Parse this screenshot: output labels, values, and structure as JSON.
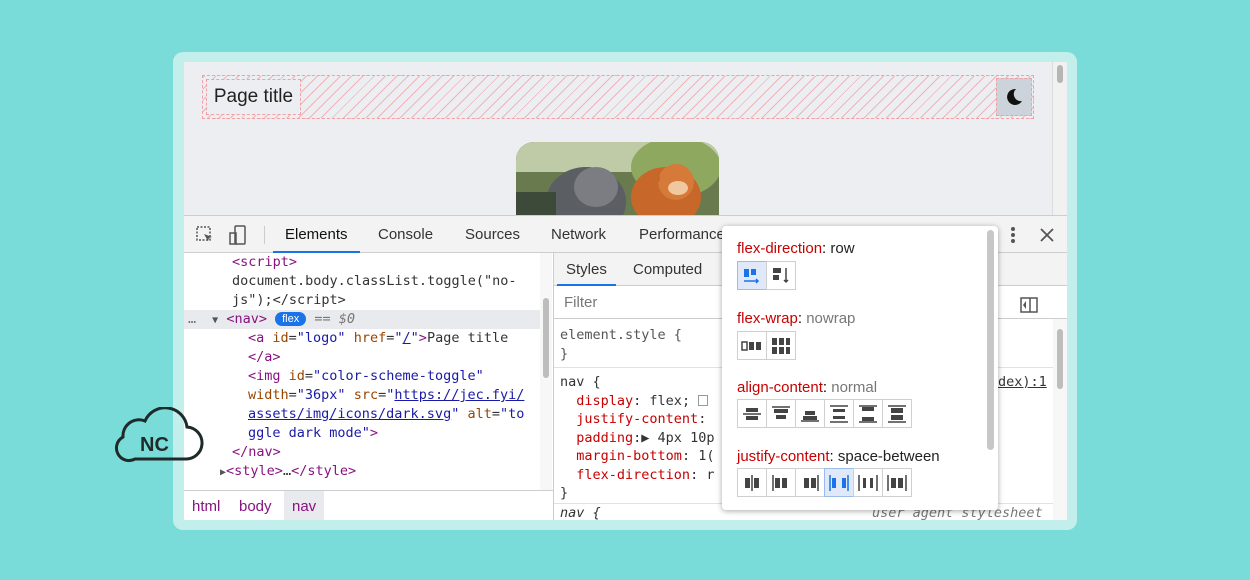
{
  "preview": {
    "page_title": "Page title"
  },
  "devtools": {
    "tabs": [
      "Elements",
      "Console",
      "Sources",
      "Network",
      "Performance"
    ],
    "elements_lines": {
      "l1": "<script>",
      "l2": "document.body.classList.toggle(\"no-",
      "l3": "js\");</script>",
      "nav_open": "<nav>",
      "flex_badge": "flex",
      "dollar": "== $0",
      "a_tag": "<a id=\"logo\" href=\"/\">Page title",
      "a_close": "</a>",
      "img_tag": "<img id=\"color-scheme-toggle\"",
      "img_width": "width=\"36px\" src=\"",
      "img_src1": "https://jec.fyi/",
      "img_src2": "assets/img/icons/dark.svg",
      "img_alt": "\" alt=\"to",
      "img_alt2": "ggle dark mode\">",
      "nav_close": "</nav>",
      "style": "<style>…</style>",
      "ellipsis": "…"
    },
    "breadcrumbs": [
      "html",
      "body",
      "nav"
    ],
    "styles_tabs": [
      "Styles",
      "Computed"
    ],
    "filter_placeholder": "Filter",
    "styles_code": {
      "element_style": "element.style {",
      "close": "}",
      "nav_rule": "nav {",
      "display": "display",
      "display_val": ": flex;",
      "justify": "justify-content",
      "justify_val": ":",
      "padding": "padding",
      "padding_val": ":▶ 4px 10p",
      "margin": "margin-bottom",
      "margin_val": ": 1(",
      "flexdir": "flex-direction",
      "flexdir_val": ": r",
      "nav_rule2": "nav {",
      "source": "dex):1",
      "ua": "user agent stylesheet"
    }
  },
  "flex_popover": {
    "flex_direction": {
      "key": "flex-direction",
      "value": "row"
    },
    "flex_wrap": {
      "key": "flex-wrap",
      "value": "nowrap"
    },
    "align_content": {
      "key": "align-content",
      "value": "normal"
    },
    "justify_content": {
      "key": "justify-content",
      "value": "space-between"
    }
  },
  "logo_badge": "NC",
  "colors": {
    "background": "#7adcd9",
    "accent": "#1a73e8",
    "css_property": "#c80000",
    "html_tag": "#881280"
  }
}
